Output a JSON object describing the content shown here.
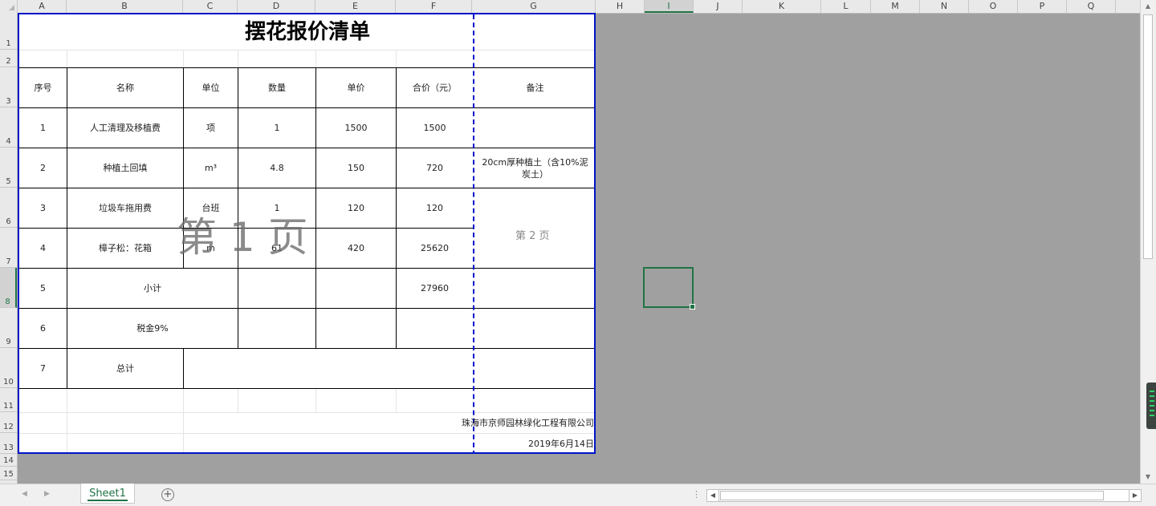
{
  "column_headers": [
    "A",
    "B",
    "C",
    "D",
    "E",
    "F",
    "G",
    "H",
    "I",
    "J",
    "K",
    "L",
    "M",
    "N",
    "O",
    "P",
    "Q"
  ],
  "row_headers": [
    "1",
    "2",
    "3",
    "4",
    "5",
    "6",
    "7",
    "8",
    "9",
    "10",
    "11",
    "12",
    "13",
    "14",
    "15"
  ],
  "sheet": {
    "title": "摆花报价清单",
    "headers": {
      "seq": "序号",
      "name": "名称",
      "unit": "单位",
      "qty": "数量",
      "price": "单价",
      "total": "合价（元）",
      "note": "备注"
    },
    "rows": [
      {
        "seq": "1",
        "name": "人工清理及移植费",
        "unit": "项",
        "qty": "1",
        "price": "1500",
        "total": "1500",
        "note": ""
      },
      {
        "seq": "2",
        "name": "种植土回填",
        "unit": "m³",
        "qty": "4.8",
        "price": "150",
        "total": "720",
        "note": "20cm厚种植土（含10%泥炭土）"
      },
      {
        "seq": "3",
        "name": "垃圾车拖用费",
        "unit": "台班",
        "qty": "1",
        "price": "120",
        "total": "120",
        "note": ""
      },
      {
        "seq": "4",
        "name": "樟子松：花箱",
        "unit": "m",
        "qty": "61",
        "price": "420",
        "total": "25620",
        "note": ""
      }
    ],
    "subtotal": {
      "seq": "5",
      "label": "小计",
      "total": "27960"
    },
    "tax": {
      "seq": "6",
      "label": "税金9%"
    },
    "grand_total": {
      "seq": "7",
      "label": "总计"
    },
    "company": "珠海市京师园林绿化工程有限公司",
    "date": "2019年6月14日"
  },
  "watermark": {
    "page1": "第 1 页",
    "page2": "第 2 页"
  },
  "selected_cell": "I8",
  "tabs": {
    "sheet1": "Sheet1",
    "add_icon": "plus-circle-icon"
  },
  "colors": {
    "page_border": "#0014c8",
    "accent": "#217346",
    "background": "#a0a0a0"
  }
}
